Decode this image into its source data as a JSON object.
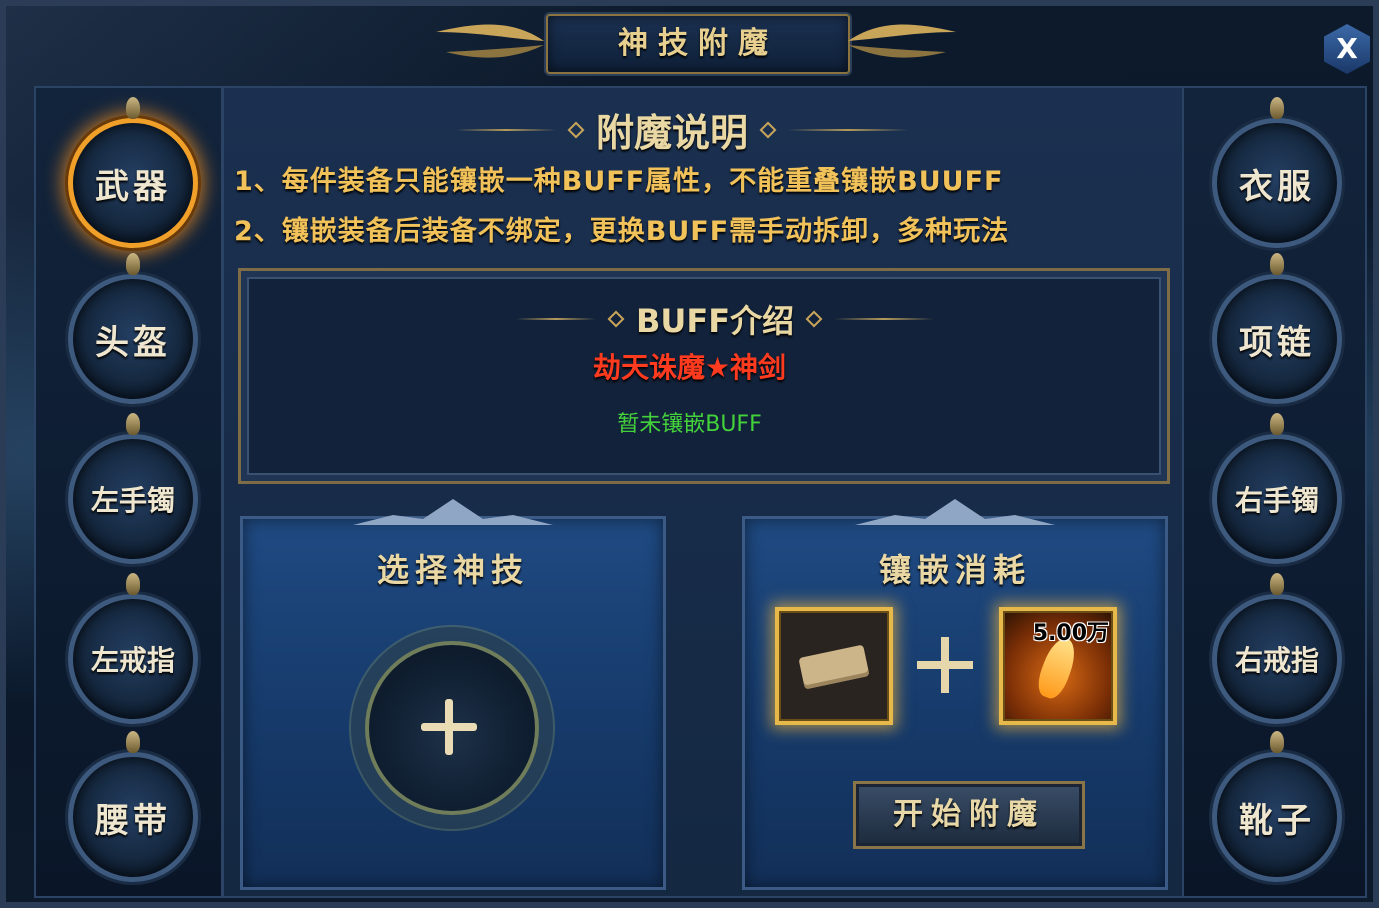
{
  "window": {
    "title": "神技附魔",
    "close_label": "X"
  },
  "left_slots": [
    {
      "label": "武器",
      "active": true
    },
    {
      "label": "头盔",
      "active": false
    },
    {
      "label": "左手镯",
      "active": false
    },
    {
      "label": "左戒指",
      "active": false
    },
    {
      "label": "腰带",
      "active": false
    }
  ],
  "right_slots": [
    {
      "label": "衣服"
    },
    {
      "label": "项链"
    },
    {
      "label": "右手镯"
    },
    {
      "label": "右戒指"
    },
    {
      "label": "靴子"
    }
  ],
  "description": {
    "title": "附魔说明",
    "rules": [
      "1、每件装备只能镶嵌一种BUFF属性，不能重叠镶嵌BUUFF",
      "2、镶嵌装备后装备不绑定，更换BUFF需手动拆卸，多种玩法"
    ]
  },
  "buff": {
    "title": "BUFF介绍",
    "item_name": "劫天诛魔★神剑",
    "status": "暂未镶嵌BUFF"
  },
  "select_panel": {
    "title": "选择神技"
  },
  "cost_panel": {
    "title": "镶嵌消耗",
    "gold_amount": "5.00万",
    "start_button": "开始附魔"
  },
  "colors": {
    "accent_gold": "#e7cf8f",
    "buff_name": "#ff3b1f",
    "buff_status": "#44d23a",
    "active_slot": "#f0a028"
  }
}
